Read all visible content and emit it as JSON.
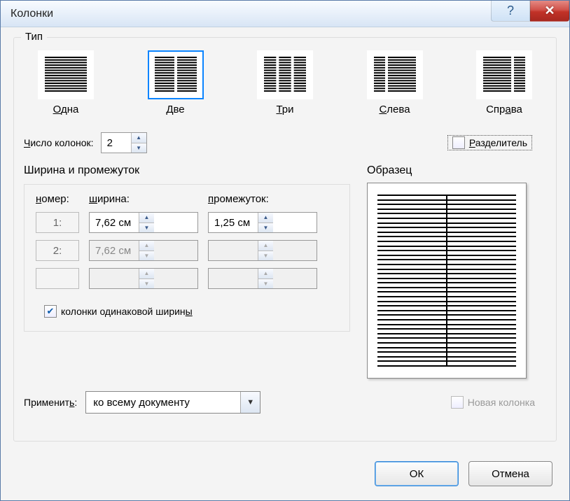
{
  "title": "Колонки",
  "type_section": {
    "label": "Тип",
    "items": [
      {
        "label": "Одна",
        "accel": "О",
        "cols": [
          1
        ]
      },
      {
        "label": "Две",
        "accel": "Д",
        "cols": [
          1,
          1
        ],
        "selected": true
      },
      {
        "label": "Три",
        "accel": "Т",
        "cols": [
          1,
          1,
          1
        ]
      },
      {
        "label": "Слева",
        "accel": "С",
        "cols": [
          0.4,
          1
        ]
      },
      {
        "label": "Справа",
        "accel": "а",
        "cols": [
          1,
          0.4
        ]
      }
    ]
  },
  "count": {
    "label": "Число колонок:",
    "accel": "Ч",
    "value": "2"
  },
  "separator": {
    "label": "Разделитель",
    "accel": "Р",
    "checked": false
  },
  "width_spacing": {
    "title": "Ширина и промежуток",
    "headers": {
      "num": "номер:",
      "num_accel": "н",
      "width": "ширина:",
      "width_accel": "ш",
      "gap": "промежуток:",
      "gap_accel": "п"
    },
    "rows": [
      {
        "num": "1:",
        "width": "7,62 см",
        "gap": "1,25 см",
        "enabled": true
      },
      {
        "num": "2:",
        "width": "7,62 см",
        "gap": "",
        "enabled": false
      },
      {
        "num": "",
        "width": "",
        "gap": "",
        "enabled": false
      }
    ],
    "equal": {
      "label": "колонки одинаковой ширины",
      "accel": "ы",
      "checked": true
    }
  },
  "preview": {
    "title": "Образец"
  },
  "apply": {
    "label": "Применить:",
    "accel": "ь",
    "value": "ко всему документу"
  },
  "new_col": {
    "label": "Новая колонка",
    "checked": false,
    "enabled": false
  },
  "buttons": {
    "ok": "ОК",
    "cancel": "Отмена"
  }
}
